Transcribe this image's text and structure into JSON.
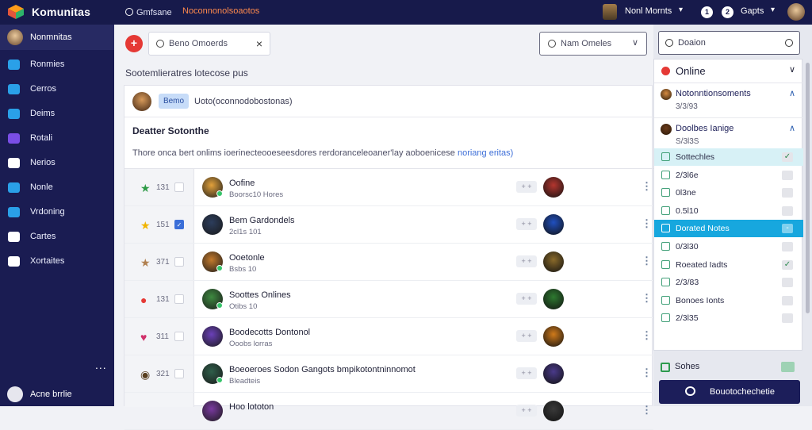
{
  "topbar": {
    "brand": "Komunitas",
    "search_label": "Gmfsane",
    "link_label": "Noconnonolsoaotos",
    "menu_label": "Nonl Mornts",
    "badge1": "1",
    "badge2": "2",
    "games_label": "Gapts"
  },
  "sidebar": {
    "head_label": "Nonmnitas",
    "items": [
      {
        "label": "Ronmies",
        "icon": "cloud-icon",
        "color": "#2aa0e8"
      },
      {
        "label": "Cerros",
        "icon": "chat-icon",
        "color": "#2aa0e8"
      },
      {
        "label": "Deims",
        "icon": "message-icon",
        "color": "#2aa0e8"
      },
      {
        "label": "Rotali",
        "icon": "box-icon",
        "color": "#7a4ee6"
      },
      {
        "label": "Nerios",
        "icon": "gear-icon",
        "color": "#ffffff"
      },
      {
        "label": "Nonle",
        "icon": "chart-icon",
        "color": "#2aa0e8"
      },
      {
        "label": "Vrdoning",
        "icon": "cloud-icon",
        "color": "#2aa0e8"
      },
      {
        "label": "Cartes",
        "icon": "controller-icon",
        "color": "#ffffff"
      },
      {
        "label": "Xortaites",
        "icon": "settings-icon",
        "color": "#ffffff"
      }
    ],
    "more": "...",
    "footer_label": "Acne brrlie"
  },
  "main": {
    "search_value": "Beno Omoerds",
    "select_value": "Nam Omeles",
    "section_title": "Sootemlieratres lotecose pus",
    "post": {
      "tag": "Bemo",
      "text": "Uoto(oconnodobostonas)"
    },
    "info_title": "Deatter Sotonthe",
    "info_desc": "Thore onca bert onlims ioerinecteooeseesdores rerdoranceleoaner'lay aoboenicese",
    "info_link": "noriang eritas)",
    "rows": [
      {
        "rank": "131",
        "star": "★",
        "star_color": "#2e9b47",
        "checked": false,
        "name": "Oofine",
        "sub": "Boorsc10 Hores",
        "online": true,
        "av": "#e2a13b",
        "gav": "#b4362f"
      },
      {
        "rank": "151",
        "star": "★",
        "star_color": "#f0b400",
        "checked": true,
        "name": "Bem Gardondels",
        "sub": "2cl1s 101",
        "online": false,
        "av": "#2c3d5c",
        "gav": "#2050c0"
      },
      {
        "rank": "371",
        "star": "★",
        "star_color": "#b08050",
        "checked": false,
        "name": "Ooetonle",
        "sub": "Bsbs 10",
        "online": true,
        "av": "#c47a2c",
        "gav": "#8a6a2a"
      },
      {
        "rank": "131",
        "star": "●",
        "star_color": "#e53935",
        "checked": false,
        "name": "Soottes Onlines",
        "sub": "Otibs 10",
        "online": true,
        "av": "#3e8a40",
        "gav": "#2e7a30"
      },
      {
        "rank": "311",
        "star": "♥",
        "star_color": "#d0306a",
        "checked": false,
        "name": "Boodecotts Dontonol",
        "sub": "Ooobs lorras",
        "online": false,
        "av": "#6a40b8",
        "gav": "#d07a1a"
      },
      {
        "rank": "321",
        "star": "◉",
        "star_color": "#5a4020",
        "checked": false,
        "name": "Boeoeroes Sodon Gangots bmpikotontninnomot",
        "sub": "Bleadteis",
        "online": true,
        "av": "#2f5e4a",
        "gav": "#4a3a8a"
      },
      {
        "rank": "",
        "star": "",
        "star_color": "#000000",
        "checked": false,
        "name": "Hoo lototon",
        "sub": "",
        "online": false,
        "av": "#7a3aa0",
        "gav": "#3a3a3a"
      }
    ]
  },
  "right": {
    "search_value": "Doaion",
    "panel_title": "Online",
    "people": [
      {
        "name": "Notonntionsoments",
        "sub": "3/3/93",
        "av": "#d58a40"
      },
      {
        "name": "Doolbes Ianige",
        "sub": "S/3l3S",
        "av": "#6a3a1a"
      }
    ],
    "items": [
      {
        "label": "Sottechles",
        "badge": "✓",
        "state": "hl"
      },
      {
        "label": "2/3l6e",
        "badge": "",
        "state": ""
      },
      {
        "label": "0l3ne",
        "badge": "",
        "state": ""
      },
      {
        "label": "0.5l10",
        "badge": "",
        "state": ""
      },
      {
        "label": "Dorated Notes",
        "badge": "-",
        "state": "sel"
      },
      {
        "label": "0/3l30",
        "badge": "",
        "state": ""
      },
      {
        "label": "Roeated Iadts",
        "badge": "✓",
        "state": ""
      },
      {
        "label": "2/3/83",
        "badge": "",
        "state": ""
      },
      {
        "label": "Bonoes Ionts",
        "badge": "",
        "state": ""
      },
      {
        "label": "2/3l35",
        "badge": "",
        "state": ""
      }
    ],
    "footer_label": "Sohes",
    "button_label": "Bouotochechetie"
  }
}
